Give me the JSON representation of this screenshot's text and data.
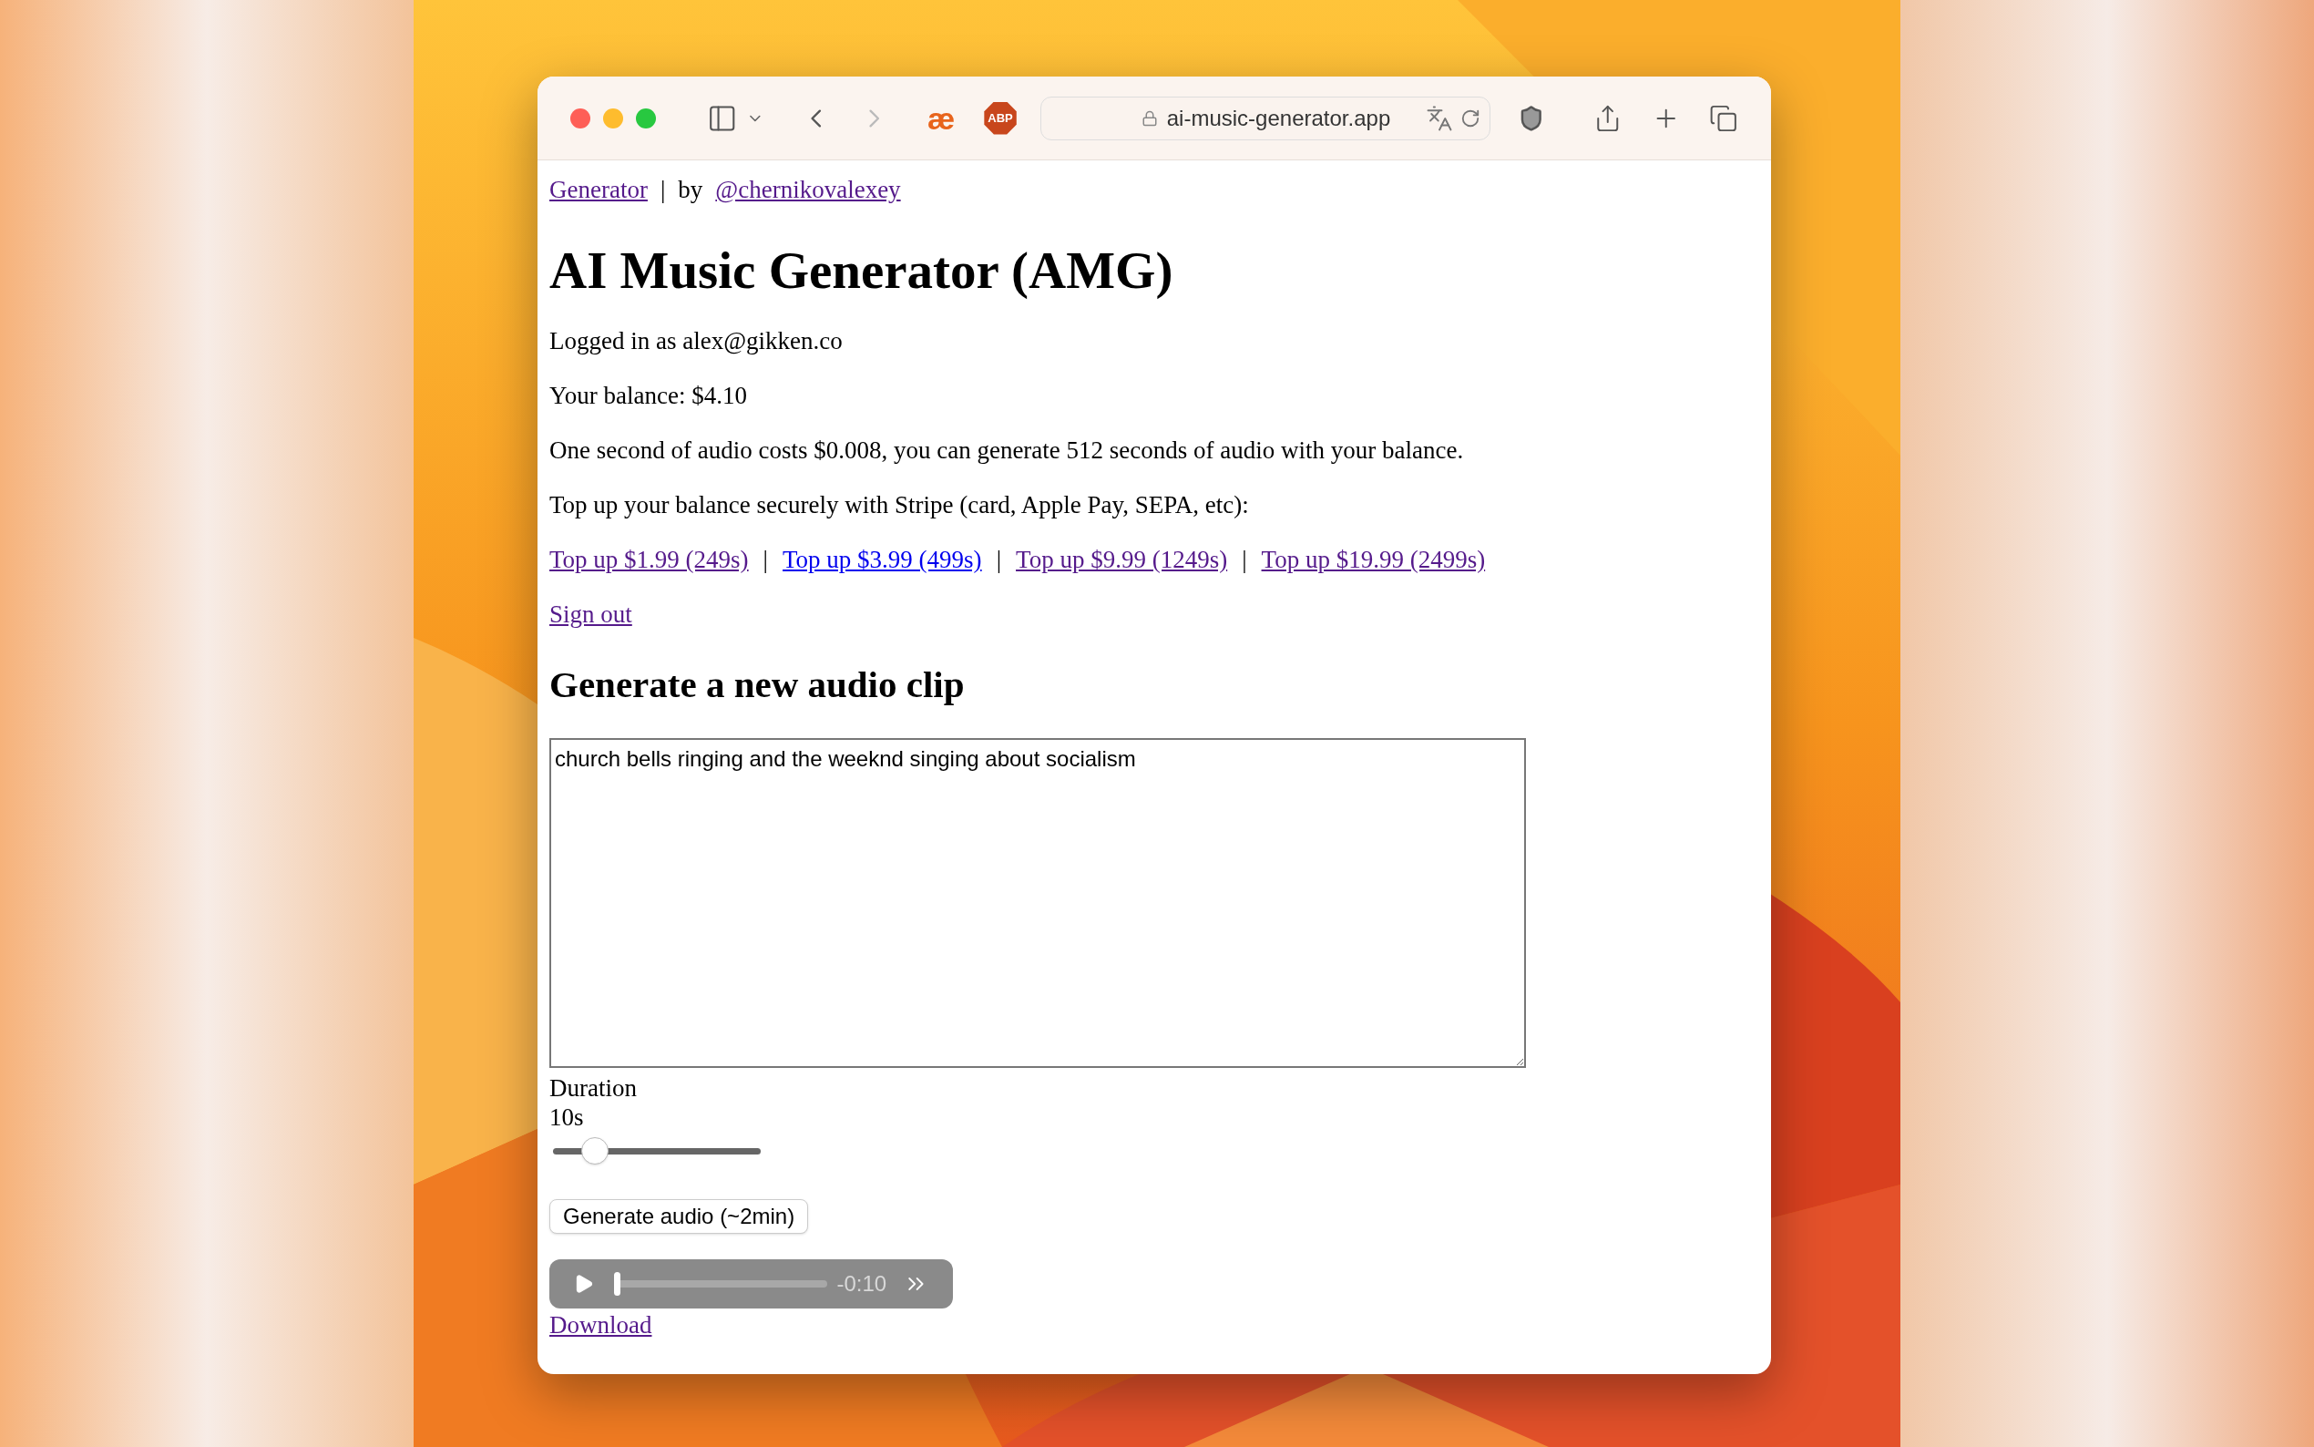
{
  "browser": {
    "address": "ai-music-generator.app",
    "extension_1": "æ",
    "extension_2": "ABP",
    "back_disabled": false,
    "forward_disabled": true
  },
  "nav": {
    "links": [
      {
        "label": "Generator",
        "visited": true
      },
      {
        "label": "@chernikovalexey",
        "visited": true
      }
    ],
    "separator": "|",
    "by": "by"
  },
  "title": "AI Music Generator (AMG)",
  "paragraphs": [
    "Logged in as alex@gikken.co",
    "Your balance: $4.10",
    "One second of audio costs $0.008, you can generate 512 seconds of audio with your balance.",
    "Top up your balance securely with Stripe (card, Apple Pay, SEPA, etc):"
  ],
  "topups": [
    {
      "label": "Top up $1.99 (249s)",
      "visited": true
    },
    {
      "label": "Top up $3.99 (499s)",
      "visited": false
    },
    {
      "label": "Top up $9.99 (1249s)",
      "visited": true
    },
    {
      "label": "Top up $19.99 (2499s)",
      "visited": true
    }
  ],
  "topup_separator": "|",
  "sign_out": {
    "label": "Sign out",
    "visited": true
  },
  "section_title": "Generate a new audio clip",
  "prompt": {
    "value": "church bells ringing and the weeknd singing about socialism"
  },
  "duration": {
    "label": "Duration",
    "reading": "10s",
    "level": 0.2
  },
  "generate_button": "Generate audio (~2min)",
  "player": {
    "time": "-0:10",
    "level": 0
  },
  "download": {
    "label": "Download",
    "visited": true
  }
}
